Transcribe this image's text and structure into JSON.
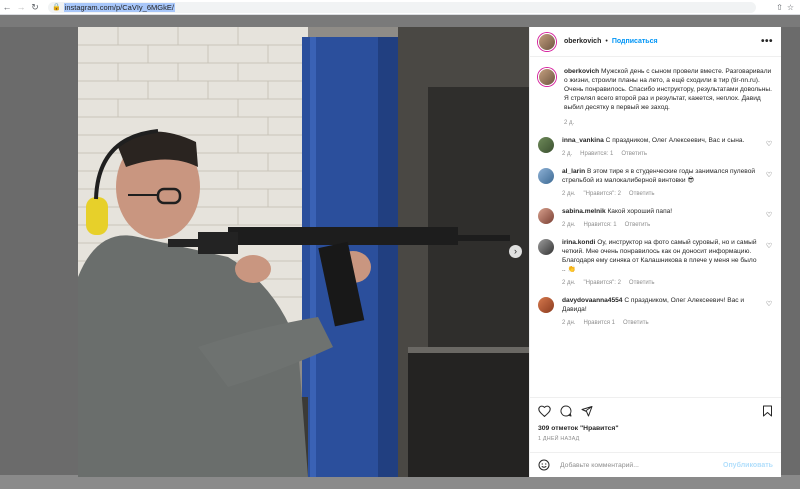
{
  "browser": {
    "url": "instagram.com/p/CaVIy_6MGkE/"
  },
  "post": {
    "image_alt": "Man in ear protection aiming a rifle at a shooting range",
    "author": "oberkovich",
    "follow_label": "Подписаться",
    "separator": "•",
    "more_label": "•••",
    "caption": "Мужской день с сыном провели вместе. Разговаривали о жизни, строили планы на лето, а ещё сходили в тир (tir-nn.ru). Очень понравилось. Спасибо инструктору, результатами довольны. Я стрелял всего второй раз и результат, кажется, неплох. Давид выбил десятку в первый же заход.",
    "caption_age": "2 д.",
    "likes": "309 отметок \"Нравится\"",
    "date": "1 ДНЕЙ НАЗАД"
  },
  "comments": [
    {
      "user": "inna_vankina",
      "text": "С праздником, Олег Алексеевич, Вас и сына.",
      "age": "2 д.",
      "likes": "Нравится: 1",
      "reply": "Ответить",
      "avatar_color": "c-green"
    },
    {
      "user": "al_larin",
      "text": "В этом тире я в студенческие годы занимался пулевой стрельбой из малокалиберной винтовки 😎",
      "age": "2 дн.",
      "likes": "\"Нравится\": 2",
      "reply": "Ответить",
      "avatar_color": "c-blue"
    },
    {
      "user": "sabina.melnik",
      "text": "Какой хороший папа!",
      "age": "2 дн.",
      "likes": "Нравится: 1",
      "reply": "Ответить",
      "avatar_color": "c-pink"
    },
    {
      "user": "irina.kondi",
      "text": "Оу, инструктор на фото самый суровый, но и самый четкий. Мне очень понравилось как он доносит информацию. Благодаря ему синяка от Калашникова в плече у меня не было .. 👏",
      "age": "2 дн.",
      "likes": "\"Нравится\": 2",
      "reply": "Ответить",
      "avatar_color": "c-dark"
    },
    {
      "user": "davydovaanna4554",
      "text": "С праздником, Олег Алексеевич! Вас и Давида!",
      "age": "2 дн.",
      "likes": "Нравится 1",
      "reply": "Ответить",
      "avatar_color": "c-red"
    }
  ],
  "comment_box": {
    "placeholder": "Добавьте комментарий...",
    "publish_label": "Опубликовать"
  },
  "icons": {
    "heart": "heart-icon",
    "comment": "comment-icon",
    "share": "share-icon",
    "save": "bookmark-icon",
    "emoji": "emoji-icon"
  },
  "colors": {
    "accent": "#0095f6",
    "publish_disabled": "#b2dffc",
    "meta_text": "#8e8e8e",
    "url_highlight": "#a8c7fa"
  }
}
